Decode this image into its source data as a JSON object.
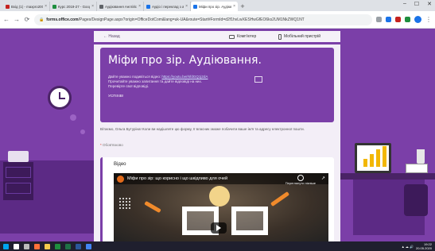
{
  "browser": {
    "tabs": [
      {
        "title": "Вхід (1) - maxpro2005@...",
        "color": "#c5221f"
      },
      {
        "title": "Курс 2019-27 - Google Д...",
        "color": "#1e8e3e"
      },
      {
        "title": "Аудіювання Англійська...",
        "color": "#5f6368"
      },
      {
        "title": "Аудіо і переклад з англ. т...",
        "color": "#1a73e8"
      },
      {
        "title": "Міфи про зір. Аудіювання.",
        "color": "#1a73e8"
      }
    ],
    "active_tab": 4,
    "new_tab": "+",
    "window_controls": [
      "–",
      "☐",
      "✕"
    ],
    "url_host": "forms.office.com",
    "url_rest": "/Pages/DesignPage.aspx?origin=OfficeDotCom&lang=uk-UA&route=Start#FormId=d2f1hvLwXESHwGfEO6ks2UM1NkZWQ1NT",
    "nav": {
      "back": "←",
      "forward": "→",
      "reload": "⟳",
      "home": "⌂"
    }
  },
  "page_header": {
    "back_label": "← Назад",
    "desktop_label": "Комп'ютер",
    "mobile_label": "Мобільний пристрій"
  },
  "form": {
    "title": "Міфи про зір. Аудіювання.",
    "desc_line1": "Дайте уважно подивіться відео: ",
    "desc_link": "https://youtu.be/rkfdGQ1j2dA",
    "desc_line2": "Прочитайте уважно запитання та дайте відповіді на них.",
    "desc_line3": "Перевірте свої відповіді.",
    "post_label": "УСПІХІВ!",
    "notice": "Вітаємо, Ольга Бутуріна! Коли ви надішлете цю форму, її власник зможе побачити ваше ім'я та адресу електронної пошти.",
    "required_mark": "*",
    "required_text": "Обов'язково",
    "video_section_label": "Відео",
    "video_title": "Міфи про зір: що корисно і що шкідливо для очей",
    "video_later": "Переглянути пізніше",
    "video_share": "↗"
  },
  "taskbar": {
    "time": "19:22",
    "date": "20.05.2020",
    "icons": [
      {
        "name": "start",
        "color": "#00a4ef"
      },
      {
        "name": "search",
        "color": "#ffffff"
      },
      {
        "name": "taskview",
        "color": "#bbbbbb"
      },
      {
        "name": "firefox",
        "color": "#ff7139"
      },
      {
        "name": "explorer",
        "color": "#f2c94c"
      },
      {
        "name": "store",
        "color": "#1e8e3e"
      },
      {
        "name": "excel",
        "color": "#1e7145"
      },
      {
        "name": "word",
        "color": "#2b579a"
      },
      {
        "name": "chrome",
        "color": "#4285f4"
      }
    ]
  },
  "colors": {
    "accent": "#7b3fa8",
    "bar": "#f2b705"
  }
}
